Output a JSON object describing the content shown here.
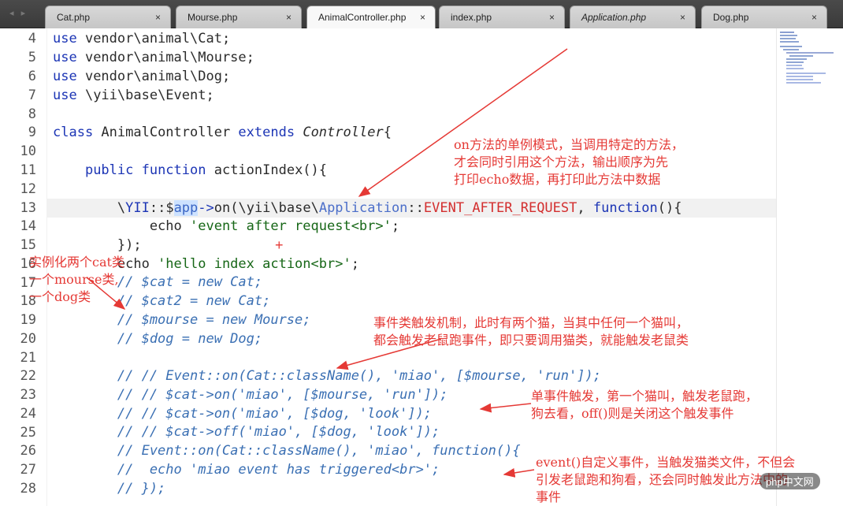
{
  "tabs": [
    {
      "label": "Cat.php",
      "close": "×"
    },
    {
      "label": "Mourse.php",
      "close": "×"
    },
    {
      "label": "AnimalController.php",
      "close": "×"
    },
    {
      "label": "index.php",
      "close": "×"
    },
    {
      "label": "Application.php",
      "close": "×"
    },
    {
      "label": "Dog.php",
      "close": "×"
    }
  ],
  "nav_arrows": "◂ ▸",
  "line_numbers": [
    "4",
    "5",
    "6",
    "7",
    "8",
    "9",
    "10",
    "11",
    "12",
    "13",
    "14",
    "15",
    "16",
    "17",
    "18",
    "19",
    "20",
    "21",
    "22",
    "23",
    "24",
    "25",
    "26",
    "27",
    "28"
  ],
  "annotations": {
    "a1": [
      "on方法的单例模式，当调用特定的方法，",
      "才会同时引用这个方法，输出顺序为先",
      "打印echo数据，再打印此方法中数据"
    ],
    "a2": [
      "实例化两个cat类",
      "一个mourse类,",
      "一个dog类"
    ],
    "a3": [
      "事件类触发机制，此时有两个猫，当其中任何一个猫叫，",
      "都会触发老鼠跑事件，即只要调用猫类，就能触发老鼠类"
    ],
    "a4": [
      "单事件触发，第一个猫叫，触发老鼠跑，",
      "狗去看，off()则是关闭这个触发事件"
    ],
    "a5": [
      "event()自定义事件，当触发猫类文件，不但会",
      "引发老鼠跑和狗看，还会同时触发此方法中的",
      "事件"
    ],
    "plus": "+"
  },
  "watermark": "php中文网"
}
